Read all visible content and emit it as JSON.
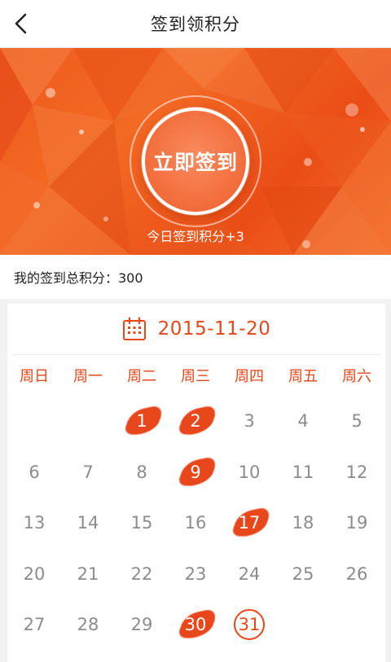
{
  "header": {
    "title": "签到领积分",
    "back_icon": "chevron-left-icon"
  },
  "banner": {
    "checkin_button_label": "立即签到",
    "today_points_text": "今日签到积分+3",
    "colors": {
      "base": "#ee5a1c",
      "light": "#f6884b",
      "dark": "#e14714"
    }
  },
  "summary": {
    "total_points_text": "我的签到总积分：300"
  },
  "calendar": {
    "icon": "calendar-icon",
    "date": "2015-11-20",
    "weekdays": [
      "周日",
      "周一",
      "周二",
      "周三",
      "周四",
      "周五",
      "周六"
    ],
    "first_weekday_index": 2,
    "days_in_month": 31,
    "signed_days": [
      1,
      2,
      9,
      17,
      30
    ],
    "today": 31,
    "accent_color": "#e8461b"
  }
}
